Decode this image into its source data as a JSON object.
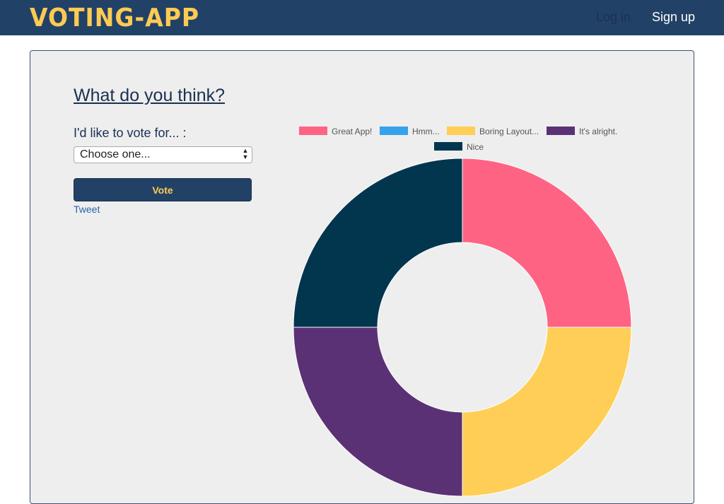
{
  "navbar": {
    "brand": "VOTING-APP",
    "login_label": "Log in",
    "signup_label": "Sign up"
  },
  "poll": {
    "question": "What do you think?",
    "vote_label": "I'd like to vote for... :",
    "select_value": "Choose one...",
    "vote_button_label": "Vote",
    "tweet_label": "Tweet"
  },
  "colors": {
    "navbar_bg": "#224166",
    "accent": "#fecb52",
    "card_bg": "#eeeeee"
  },
  "chart_data": {
    "type": "pie",
    "title": "",
    "legend_position": "top",
    "series": [
      {
        "name": "Great App!",
        "value": 1,
        "color": "#ff6384"
      },
      {
        "name": "Hmm...",
        "value": 0,
        "color": "#36a2eb"
      },
      {
        "name": "Boring Layout...",
        "value": 1,
        "color": "#ffce56"
      },
      {
        "name": "It's alright.",
        "value": 1,
        "color": "#5b3175"
      },
      {
        "name": "Nice",
        "value": 1,
        "color": "#02364e"
      }
    ]
  }
}
